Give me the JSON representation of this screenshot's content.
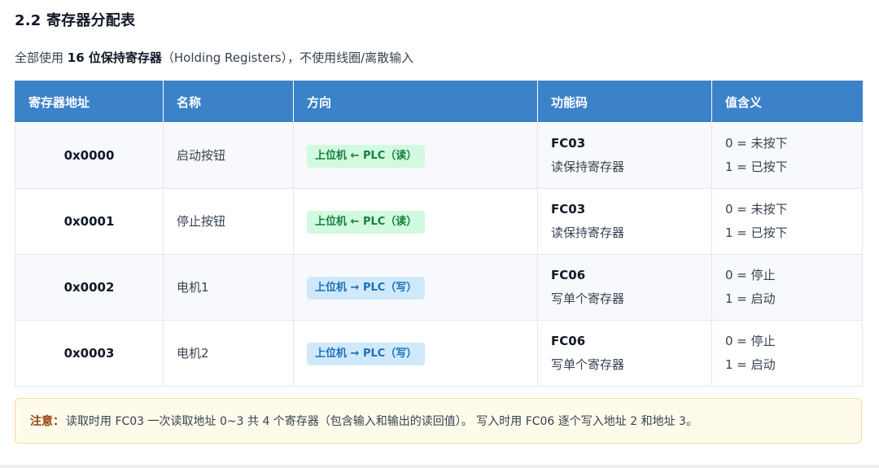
{
  "section": {
    "title": "2.2 寄存器分配表"
  },
  "intro": {
    "prefix": "全部使用 ",
    "bold": "16 位保持寄存器",
    "suffix": "（Holding Registers），不使用线圈/离散输入"
  },
  "table": {
    "headers": [
      "寄存器地址",
      "名称",
      "方向",
      "功能码",
      "值含义"
    ],
    "rows": [
      {
        "address": "0x0000",
        "name": "启动按钮",
        "direction": "上位机 ← PLC（读）",
        "direction_type": "read",
        "fc_code": "FC03",
        "fc_desc": "读保持寄存器",
        "value_0": "0 = 未按下",
        "value_1": "1 = 已按下"
      },
      {
        "address": "0x0001",
        "name": "停止按钮",
        "direction": "上位机 ← PLC（读）",
        "direction_type": "read",
        "fc_code": "FC03",
        "fc_desc": "读保持寄存器",
        "value_0": "0 = 未按下",
        "value_1": "1 = 已按下"
      },
      {
        "address": "0x0002",
        "name": "电机1",
        "direction": "上位机 → PLC（写）",
        "direction_type": "write",
        "fc_code": "FC06",
        "fc_desc": "写单个寄存器",
        "value_0": "0 = 停止",
        "value_1": "1 = 启动"
      },
      {
        "address": "0x0003",
        "name": "电机2",
        "direction": "上位机 → PLC（写）",
        "direction_type": "write",
        "fc_code": "FC06",
        "fc_desc": "写单个寄存器",
        "value_0": "0 = 停止",
        "value_1": "1 = 启动"
      }
    ]
  },
  "note": {
    "label": "注意：",
    "text": "读取时用 FC03 一次读取地址 0~3 共 4 个寄存器（包含输入和输出的读回值）。 写入时用 FC06 逐个写入地址 2 和地址 3。"
  },
  "colors": {
    "header_bg": "#3b82c9",
    "read_badge_bg": "#d1fae0",
    "read_badge_text": "#15803d",
    "write_badge_bg": "#cfe9fb",
    "write_badge_text": "#1d6fb8",
    "note_bg": "#fffbeb",
    "note_border": "#fcd89a"
  }
}
